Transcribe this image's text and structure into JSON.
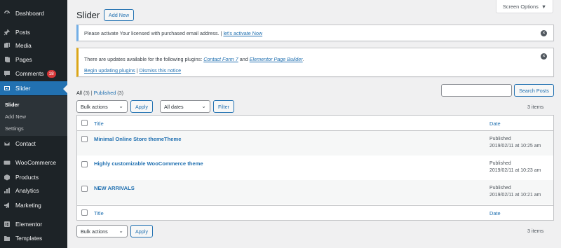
{
  "sidebar": {
    "items": [
      {
        "label": "Dashboard",
        "icon": "dashboard-icon"
      },
      {
        "label": "Posts",
        "icon": "pin-icon"
      },
      {
        "label": "Media",
        "icon": "media-icon"
      },
      {
        "label": "Pages",
        "icon": "page-icon"
      },
      {
        "label": "Comments",
        "icon": "comment-icon",
        "badge": "18"
      },
      {
        "label": "Slider",
        "icon": "slider-icon",
        "active": true
      },
      {
        "label": "Contact",
        "icon": "mail-icon"
      },
      {
        "label": "WooCommerce",
        "icon": "woo-icon"
      },
      {
        "label": "Products",
        "icon": "box-icon"
      },
      {
        "label": "Analytics",
        "icon": "bar-chart-icon"
      },
      {
        "label": "Marketing",
        "icon": "megaphone-icon"
      },
      {
        "label": "Elementor",
        "icon": "elementor-icon"
      },
      {
        "label": "Templates",
        "icon": "folder-icon"
      }
    ],
    "submenu": [
      {
        "label": "Slider",
        "current": true
      },
      {
        "label": "Add New"
      },
      {
        "label": "Settings"
      }
    ]
  },
  "header": {
    "title": "Slider",
    "add_new": "Add New",
    "screen_options": "Screen Options"
  },
  "notices": {
    "license": {
      "text": "Please activate Your licensed with purchased email address. |",
      "link": "let's activate Now"
    },
    "updates": {
      "text_before": "There are updates available for the following plugins:",
      "plugin1": "Contact Form 7",
      "and": "and",
      "plugin2": "Elementor Page Builder",
      "period": ".",
      "begin_link": "Begin updating plugins",
      "sep": "|",
      "dismiss_link": "Dismiss this notice"
    }
  },
  "views": {
    "all": "All",
    "all_count": "(3)",
    "sep": "|",
    "published": "Published",
    "published_count": "(3)"
  },
  "search": {
    "button": "Search Posts",
    "value": ""
  },
  "top_nav": {
    "bulk_actions": "Bulk actions",
    "apply": "Apply",
    "dates": "All dates",
    "filter": "Filter",
    "items": "3 items"
  },
  "table": {
    "col_title": "Title",
    "col_date": "Date",
    "rows": [
      {
        "title": "Minimal Online Store themeTheme",
        "status": "Published",
        "date": "2019/02/11 at 10:25 am"
      },
      {
        "title": "Highly customizable WooCommerce theme",
        "status": "Published",
        "date": "2019/02/11 at 10:23 am"
      },
      {
        "title": "NEW ARRIVALS",
        "status": "Published",
        "date": "2019/02/11 at 10:21 am"
      }
    ]
  },
  "bottom_nav": {
    "bulk_actions": "Bulk actions",
    "apply": "Apply",
    "items": "3 items"
  }
}
